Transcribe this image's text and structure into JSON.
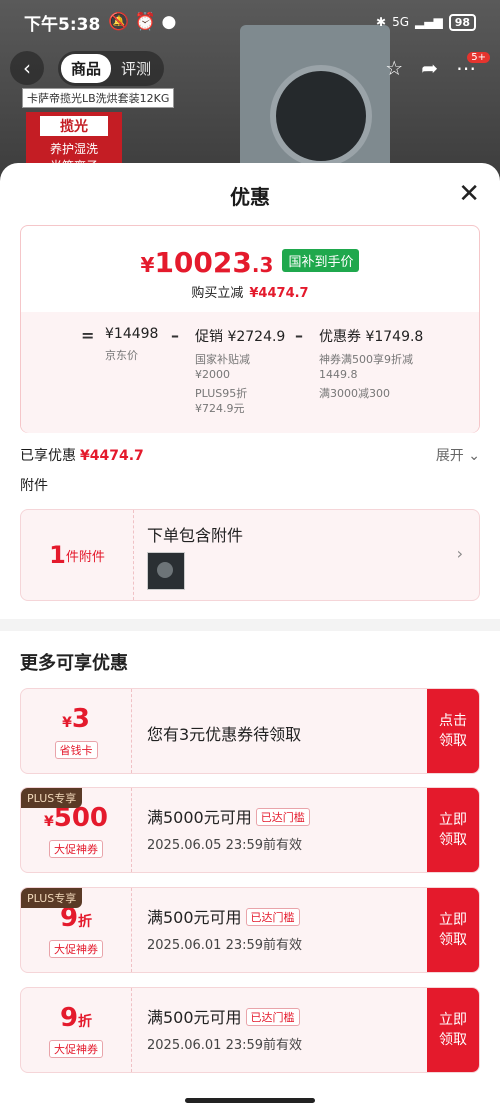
{
  "status": {
    "time": "下午5:38",
    "network": "5G",
    "battery": "98"
  },
  "product_header": {
    "tabs": [
      "商品",
      "评测"
    ],
    "badge": "5+",
    "label": "卡萨帝揽光LB洗烘套装12KG",
    "box_title": "揽光",
    "box_lines": [
      "养护湿洗",
      "光笙离子"
    ]
  },
  "sheet": {
    "title": "优惠",
    "price": {
      "currency": "¥",
      "integer": "10023",
      "decimal": ".3",
      "tag": "国补到手价"
    },
    "reduce": {
      "label": "购买立减",
      "value": "¥4474.7"
    },
    "breakdown": {
      "eq": "=",
      "jd_price": "¥14498",
      "jd_label": "京东价",
      "minus1": "–",
      "promo": "促销 ¥2724.9",
      "promo_sub1": "国家补贴减",
      "promo_sub1b": "¥2000",
      "promo_sub2": "PLUS95折",
      "promo_sub2b": "¥724.9元",
      "minus2": "–",
      "coupon": "优惠券 ¥1749.8",
      "coupon_sub1": "神券满500享9折减",
      "coupon_sub1b": "1449.8",
      "coupon_sub2": "满3000减300"
    },
    "enjoyed": {
      "label": "已享优惠",
      "value": "¥4474.7",
      "expand": "展开"
    },
    "accessory_label": "附件",
    "accessory": {
      "count": "1",
      "unit": "件附件",
      "title": "下单包含附件"
    },
    "more_title": "更多可享优惠",
    "coupons": [
      {
        "plus": "",
        "cur": "¥",
        "amount": "3",
        "unit": "",
        "tag": "省钱卡",
        "text": "您有3元优惠券待领取",
        "cond": "",
        "met": "",
        "date": "",
        "btn1": "点击",
        "btn2": "领取"
      },
      {
        "plus": "PLUS专享",
        "cur": "¥",
        "amount": "500",
        "unit": "",
        "tag": "大促神券",
        "text": "",
        "cond": "满5000元可用",
        "met": "已达门槛",
        "date": "2025.06.05 23:59前有效",
        "btn1": "立即",
        "btn2": "领取"
      },
      {
        "plus": "PLUS专享",
        "cur": "",
        "amount": "9",
        "unit": "折",
        "tag": "大促神券",
        "text": "",
        "cond": "满500元可用",
        "met": "已达门槛",
        "date": "2025.06.01 23:59前有效",
        "btn1": "立即",
        "btn2": "领取"
      },
      {
        "plus": "",
        "cur": "",
        "amount": "9",
        "unit": "折",
        "tag": "大促神券",
        "text": "",
        "cond": "满500元可用",
        "met": "已达门槛",
        "date": "2025.06.01 23:59前有效",
        "btn1": "立即",
        "btn2": "领取"
      }
    ]
  }
}
